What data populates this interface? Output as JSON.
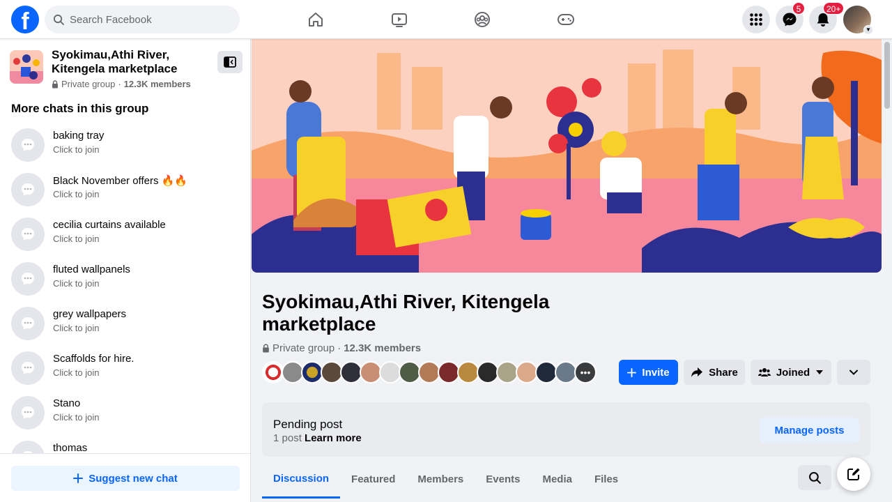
{
  "topbar": {
    "logo_letter": "f",
    "search_placeholder": "Search Facebook",
    "nav_icons": [
      "home-icon",
      "video-icon",
      "groups-icon",
      "gaming-icon"
    ],
    "messenger_badge": "5",
    "notifications_badge": "20+"
  },
  "sidebar": {
    "group_name": "Syokimau,Athi River, Kitengela marketplace",
    "privacy": "Private group",
    "separator": "·",
    "members": "12.3K members",
    "chats_heading": "More chats in this group",
    "chats": [
      {
        "name": "baking tray",
        "sub": "Click to join"
      },
      {
        "name": "Black November offers 🔥🔥",
        "sub": "Click to join"
      },
      {
        "name": "cecilia curtains available",
        "sub": "Click to join"
      },
      {
        "name": "fluted wallpanels",
        "sub": "Click to join"
      },
      {
        "name": "grey wallpapers",
        "sub": "Click to join"
      },
      {
        "name": "Scaffolds for hire.",
        "sub": "Click to join"
      },
      {
        "name": "Stano",
        "sub": "Click to join"
      },
      {
        "name": "thomas",
        "sub": ""
      }
    ],
    "suggest_label": "Suggest new chat"
  },
  "main": {
    "title": "Syokimau,Athi River, Kitengela marketplace",
    "privacy": "Private group",
    "separator": "·",
    "members": "12.3K members",
    "invite_label": "Invite",
    "share_label": "Share",
    "joined_label": "Joined",
    "pending_title": "Pending post",
    "pending_count": "1 post",
    "pending_link": "Learn more",
    "manage_label": "Manage posts",
    "tabs": [
      "Discussion",
      "Featured",
      "Members",
      "Events",
      "Media",
      "Files"
    ],
    "active_tab": "Discussion"
  },
  "colors": {
    "brand": "#0866ff",
    "badge": "#e41e3f"
  }
}
